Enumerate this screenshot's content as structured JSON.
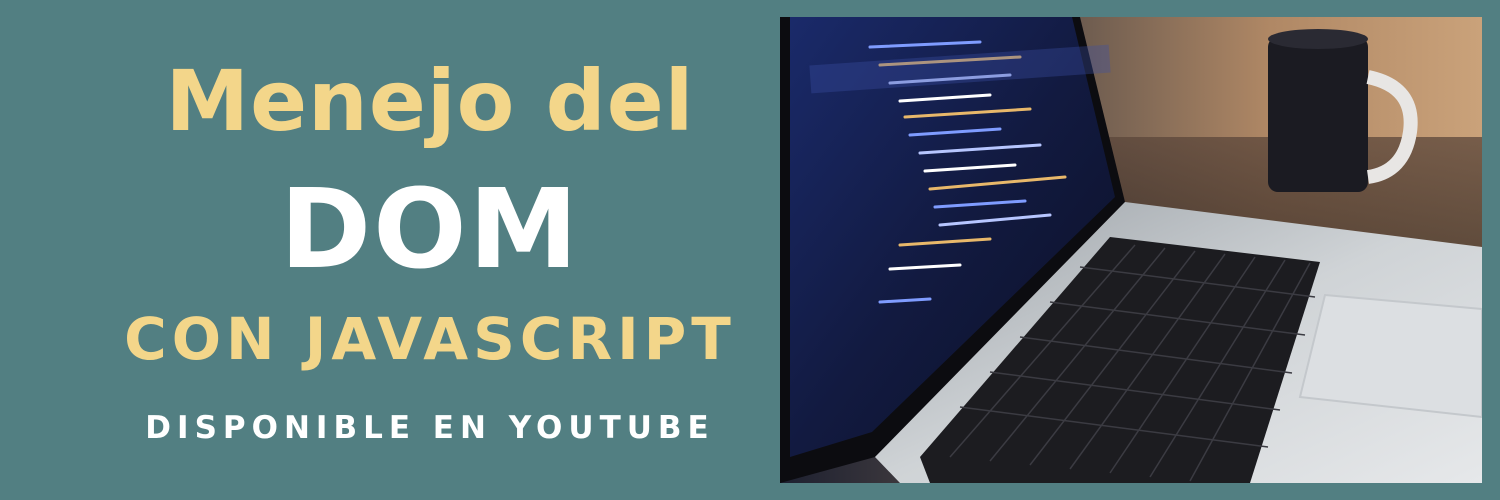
{
  "banner": {
    "title_line1": "Menejo del",
    "title_line2": "DOM",
    "title_line3": "CON JAVASCRIPT",
    "subtitle": "DISPONIBLE EN YOUTUBE"
  },
  "colors": {
    "background": "#527f82",
    "accent_yellow": "#f3d68a",
    "text_white": "#ffffff"
  },
  "photo": {
    "icon": "laptop-code-photo"
  }
}
